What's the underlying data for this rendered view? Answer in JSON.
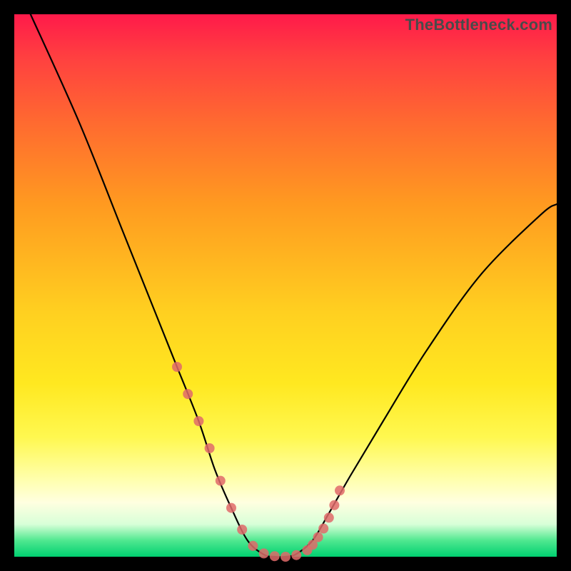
{
  "watermark": "TheBottleneck.com",
  "chart_data": {
    "type": "line",
    "title": "",
    "xlabel": "",
    "ylabel": "",
    "xlim": [
      0,
      100
    ],
    "ylim": [
      0,
      100
    ],
    "series": [
      {
        "name": "bottleneck-curve",
        "x": [
          3,
          12,
          20,
          26,
          30,
          34,
          37,
          40,
          43,
          46,
          48,
          50,
          52,
          55,
          58,
          62,
          68,
          76,
          86,
          97,
          100
        ],
        "values": [
          100,
          80,
          60,
          45,
          35,
          25,
          16,
          9,
          3,
          0.4,
          0,
          0,
          0.5,
          3,
          8,
          15,
          25,
          38,
          52,
          63,
          65
        ]
      }
    ],
    "markers": {
      "name": "highlight-points",
      "color": "#e06a6a",
      "x": [
        30,
        32,
        34,
        36,
        38,
        40,
        42,
        44,
        46,
        48,
        50,
        52,
        54,
        55,
        56,
        57,
        58,
        59,
        60
      ],
      "values": [
        35,
        30,
        25,
        20,
        14,
        9,
        5,
        2,
        0.6,
        0.1,
        0,
        0.3,
        1.2,
        2.2,
        3.6,
        5.2,
        7.2,
        9.5,
        12.2
      ]
    },
    "gradient_stops": [
      {
        "pos": 0.0,
        "color": "#ff1a4a"
      },
      {
        "pos": 0.35,
        "color": "#ff9a20"
      },
      {
        "pos": 0.68,
        "color": "#ffe820"
      },
      {
        "pos": 0.9,
        "color": "#ffffe0"
      },
      {
        "pos": 1.0,
        "color": "#00d070"
      }
    ]
  }
}
